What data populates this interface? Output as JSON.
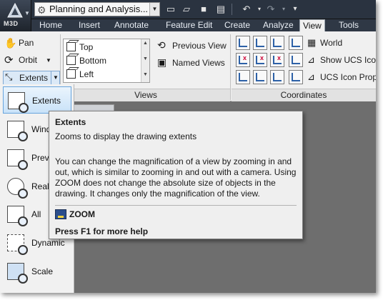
{
  "app": {
    "badge": "M3D",
    "workspace_name": "Planning and Analysis..."
  },
  "tabs": [
    {
      "label": "Home"
    },
    {
      "label": "Insert"
    },
    {
      "label": "Annotate"
    },
    {
      "label": "Feature Edit"
    },
    {
      "label": "Create"
    },
    {
      "label": "Analyze"
    },
    {
      "label": "View"
    },
    {
      "label": "Tools"
    }
  ],
  "active_tab": "View",
  "navigate": {
    "pan": "Pan",
    "orbit": "Orbit",
    "extents": "Extents"
  },
  "views_panel": {
    "title": "Views",
    "items": [
      "Top",
      "Bottom",
      "Left"
    ],
    "previous_view": "Previous View",
    "named_views": "Named Views"
  },
  "coordinates_panel": {
    "title": "Coordinates",
    "world": "World",
    "show_ucs_icon": "Show UCS Ico",
    "ucs_icon_properties": "UCS Icon Propertie"
  },
  "zoom_menu": [
    {
      "label": "Extents",
      "icon": "zoom-extents-icon",
      "selected": true
    },
    {
      "label": "Wind",
      "icon": "zoom-window-icon",
      "selected": false
    },
    {
      "label": "Previ",
      "icon": "zoom-previous-icon",
      "selected": false
    },
    {
      "label": "Realt",
      "icon": "zoom-realtime-icon",
      "selected": false
    },
    {
      "label": "All",
      "icon": "zoom-all-icon",
      "selected": false
    },
    {
      "label": "Dynamic",
      "icon": "zoom-dynamic-icon",
      "selected": false
    },
    {
      "label": "Scale",
      "icon": "zoom-scale-icon",
      "selected": false
    }
  ],
  "tooltip": {
    "title": "Extents",
    "subtitle": "Zooms to display the drawing extents",
    "body": "You can change the magnification of a view by zooming in and out, which is similar to zooming in and out with a camera. Using ZOOM does not change the absolute size of objects in the drawing. It changes only the magnification of the view.",
    "command": "ZOOM",
    "help": "Press F1 for more help"
  },
  "colors": {
    "titlebar": "#2a3340",
    "ribbon": "#f0f0f0",
    "selection": "#c9e2f8",
    "canvas": "#6e6e6e"
  }
}
